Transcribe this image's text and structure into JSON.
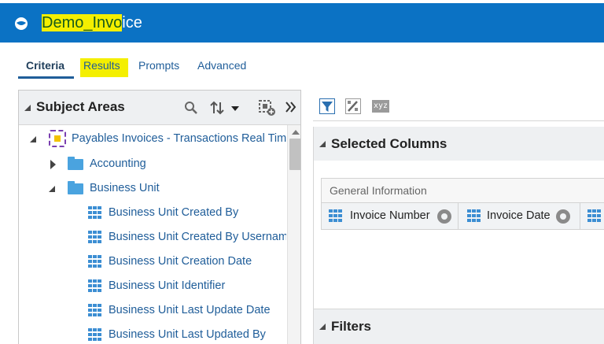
{
  "header": {
    "title_highlighted": "Demo_Invo",
    "title_rest": "ice",
    "logo_icon": "oracle-analytics-logo-icon",
    "bg_color": "#0b72c4"
  },
  "tabs": [
    {
      "label": "Criteria",
      "active": true
    },
    {
      "label": "Results",
      "active": false
    },
    {
      "label": "Prompts",
      "active": false
    },
    {
      "label": "Advanced",
      "active": false
    }
  ],
  "subject_areas": {
    "title": "Subject Areas",
    "icons": [
      "search-icon",
      "sort-icon",
      "add-subject-area-icon",
      "collapse-panel-icon"
    ],
    "tree": [
      {
        "label": "Payables Invoices - Transactions Real Time",
        "type": "subject-area",
        "expanded": true
      },
      {
        "label": "Accounting",
        "type": "folder",
        "expanded": false
      },
      {
        "label": "Business Unit",
        "type": "folder",
        "expanded": true
      },
      {
        "label": "Business Unit Created By",
        "type": "column"
      },
      {
        "label": "Business Unit Created By Username",
        "type": "column"
      },
      {
        "label": "Business Unit Creation Date",
        "type": "column"
      },
      {
        "label": "Business Unit Identifier",
        "type": "column"
      },
      {
        "label": "Business Unit Last Update Date",
        "type": "column"
      },
      {
        "label": "Business Unit Last Updated By",
        "type": "column"
      }
    ]
  },
  "toolbar": {
    "icons": [
      "filter-icon",
      "edit-formula-icon",
      "xyz-icon"
    ],
    "xyz_label": "xyz"
  },
  "selected_columns": {
    "title": "Selected Columns",
    "group_label": "General Information",
    "columns": [
      "Invoice Number",
      "Invoice Date"
    ]
  },
  "filters": {
    "title": "Filters"
  }
}
